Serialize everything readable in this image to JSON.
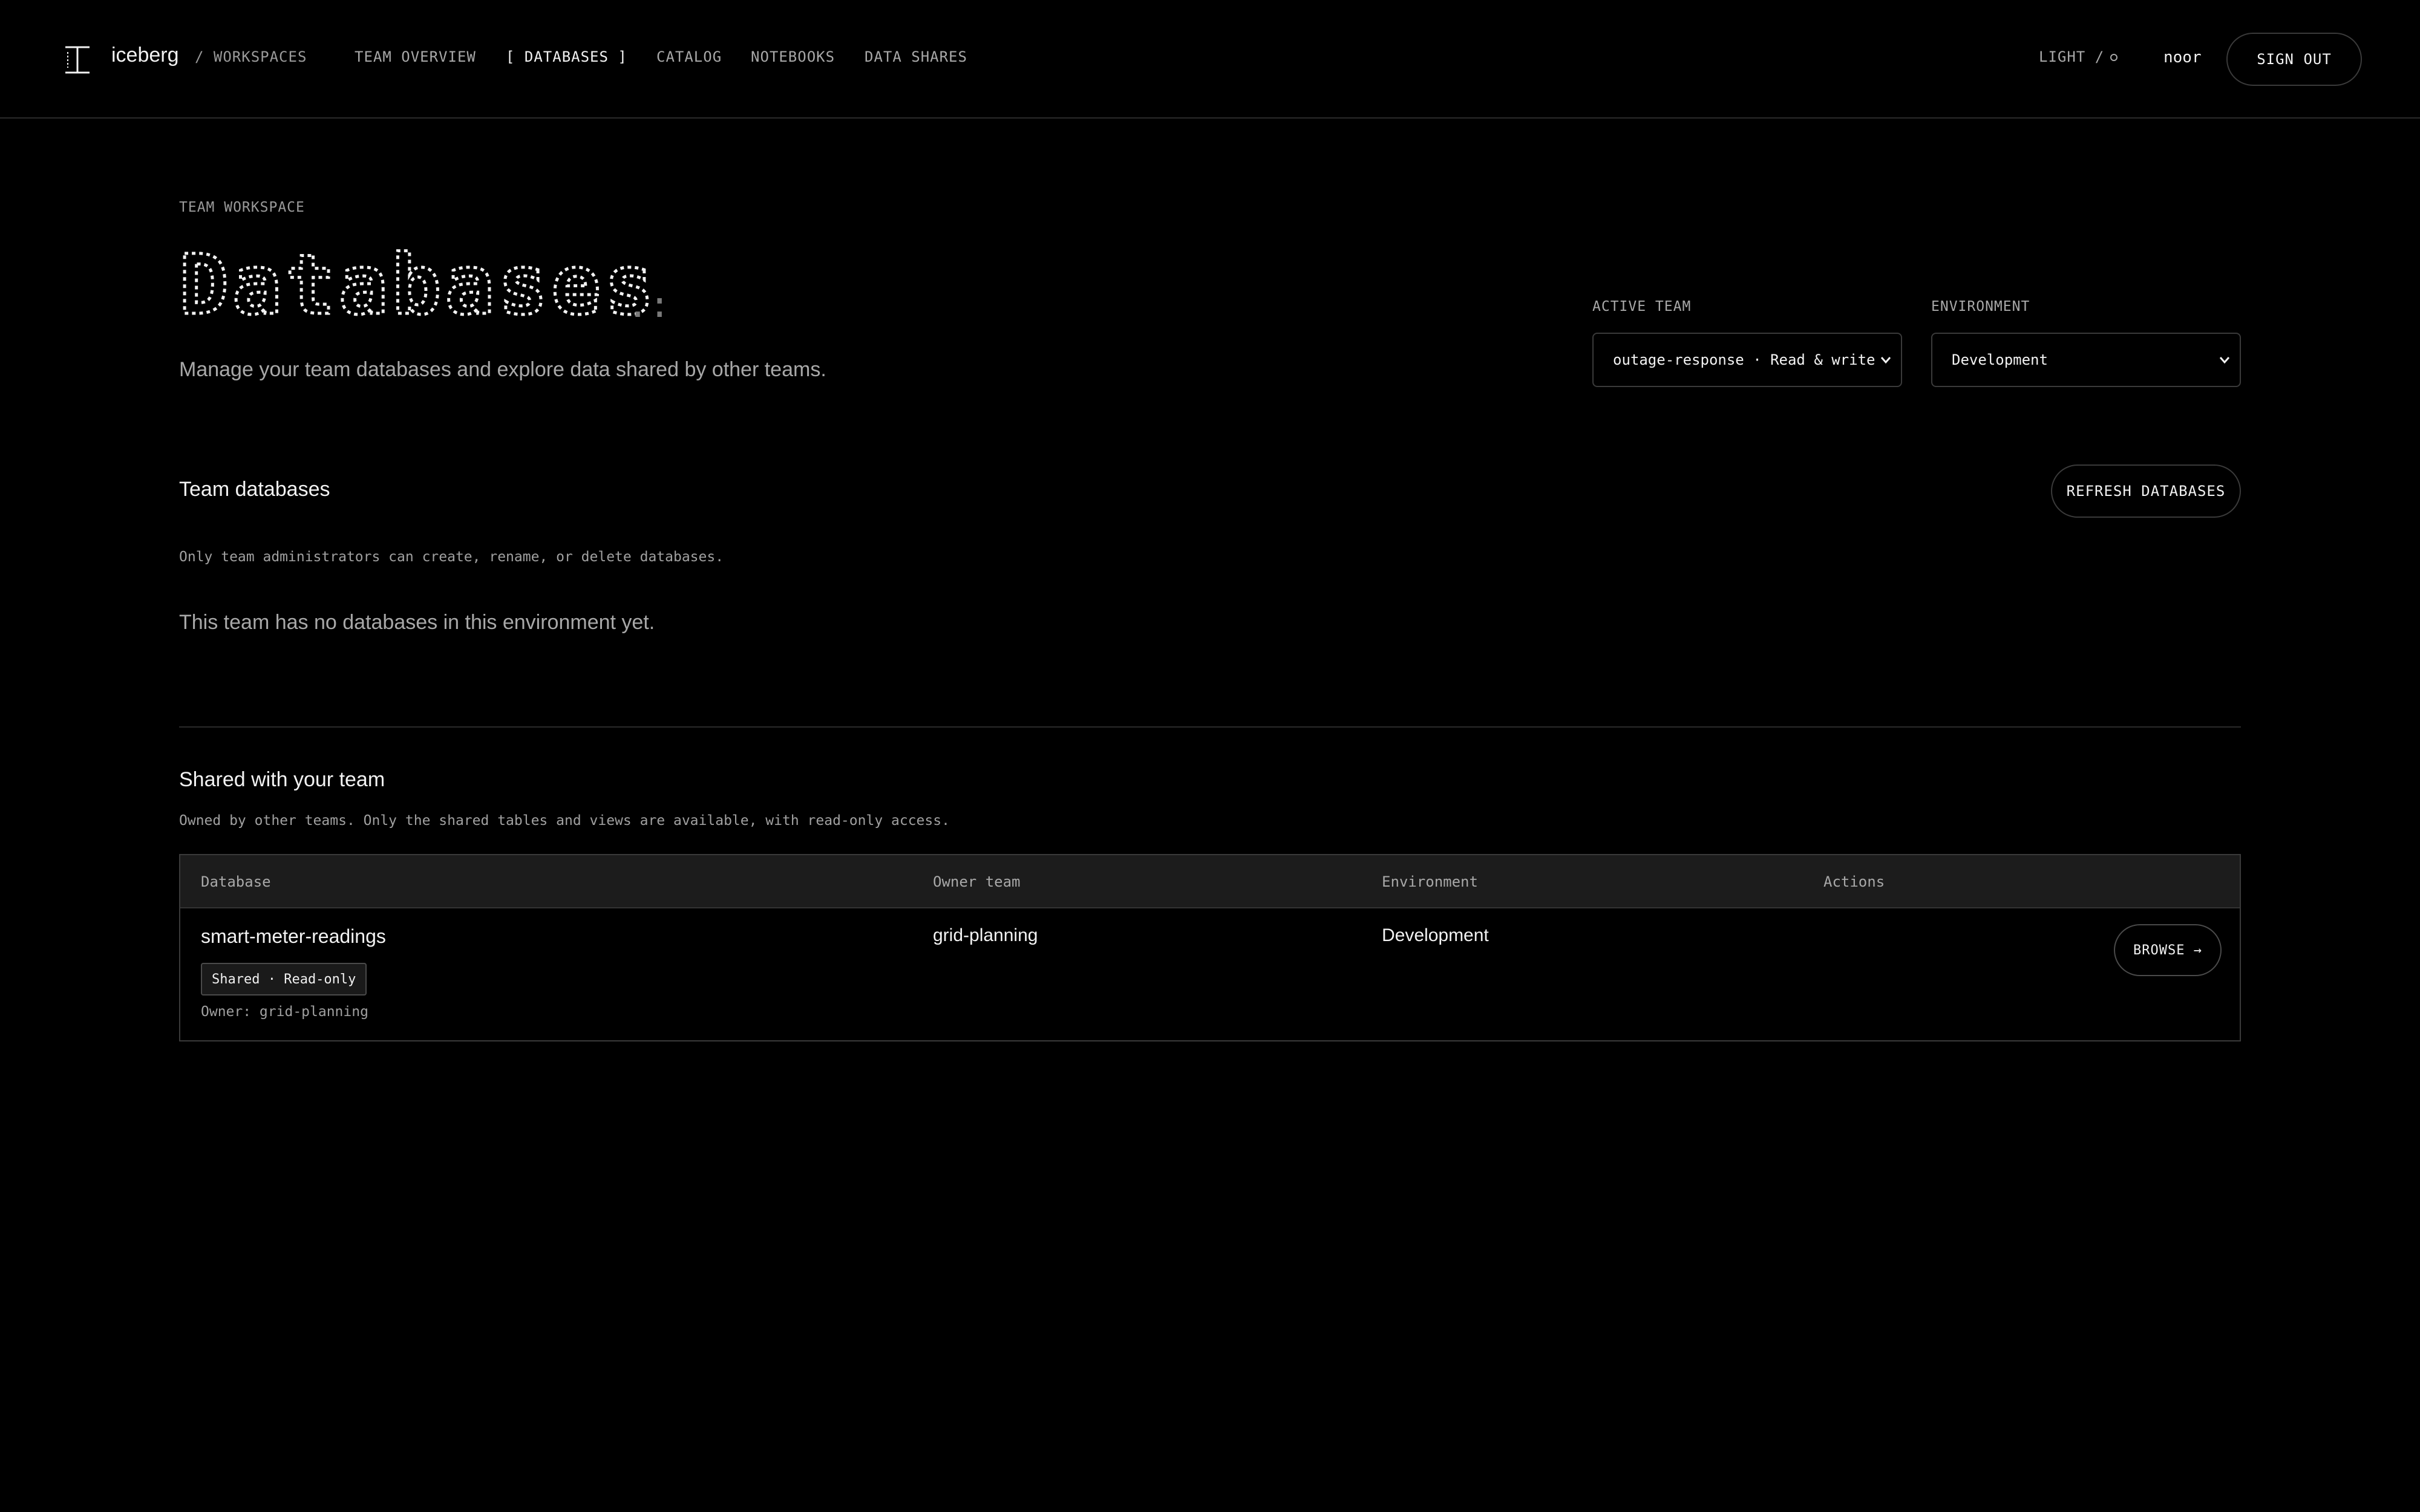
{
  "app": {
    "brand": "iceberg",
    "breadcrumb": "/ WORKSPACES"
  },
  "nav": {
    "items": [
      {
        "label": "TEAM OVERVIEW",
        "active": false
      },
      {
        "label": "[ DATABASES ]",
        "active": true
      },
      {
        "label": "CATALOG",
        "active": false
      },
      {
        "label": "NOTEBOOKS",
        "active": false
      },
      {
        "label": "DATA SHARES",
        "active": false
      }
    ]
  },
  "header_right": {
    "theme_label": "LIGHT /",
    "user": "noor",
    "sign_out_label": "SIGN OUT"
  },
  "page": {
    "eyebrow": "TEAM WORKSPACE",
    "title": "Databases",
    "subtitle": "Manage your team databases and explore data shared by other teams."
  },
  "filters": {
    "active_team_label": "ACTIVE TEAM",
    "active_team_value": "outage-response · Read & write",
    "environment_label": "ENVIRONMENT",
    "environment_value": "Development"
  },
  "team_databases": {
    "title": "Team databases",
    "refresh_label": "REFRESH DATABASES",
    "note": "Only team administrators can create, rename, or delete databases.",
    "empty_message": "This team has no databases in this environment yet."
  },
  "shared": {
    "title": "Shared with your team",
    "note": "Owned by other teams. Only the shared tables and views are available, with read-only access.",
    "columns": [
      "Database",
      "Owner team",
      "Environment",
      "Actions"
    ],
    "rows": [
      {
        "database": "smart-meter-readings",
        "badge": "Shared · Read-only",
        "owner_line": "Owner: grid-planning",
        "owner_team": "grid-planning",
        "environment": "Development",
        "action_label": "BROWSE →"
      }
    ]
  },
  "colors": {
    "background": "#000000",
    "text_primary": "#f2f2f2",
    "text_muted": "#a8a8a8",
    "border": "#3a3a3a",
    "table_header": "#1c1c1c"
  },
  "icons": {
    "logo": "iceberg-logo-icon",
    "chevron": "chevron-down-icon"
  }
}
